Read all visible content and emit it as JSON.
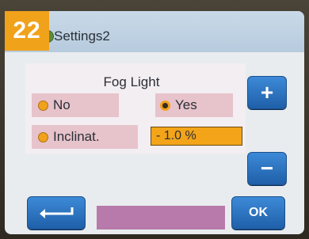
{
  "badge": "22",
  "window": {
    "title": "Settings2"
  },
  "section": {
    "title": "Fog Light"
  },
  "options": {
    "no_label": "No",
    "yes_label": "Yes",
    "selected": "Yes"
  },
  "inclination": {
    "label": "Inclinat.",
    "value": "- 1.0 %"
  },
  "buttons": {
    "plus": "+",
    "minus": "−",
    "ok": "OK",
    "back_icon": "return-arrow-icon"
  },
  "colors": {
    "accent_orange": "#f0a21b",
    "button_blue": "#2a75c7",
    "option_pink": "#e7c3cb",
    "bar_purple": "#b77aaa"
  }
}
